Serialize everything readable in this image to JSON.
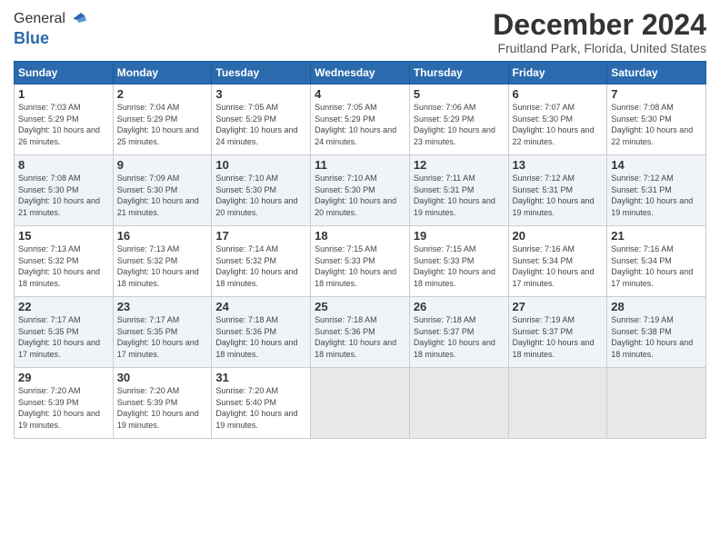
{
  "header": {
    "logo_general": "General",
    "logo_blue": "Blue",
    "month_title": "December 2024",
    "location": "Fruitland Park, Florida, United States"
  },
  "calendar": {
    "days_of_week": [
      "Sunday",
      "Monday",
      "Tuesday",
      "Wednesday",
      "Thursday",
      "Friday",
      "Saturday"
    ],
    "weeks": [
      [
        {
          "day": "",
          "empty": true
        },
        {
          "day": "",
          "empty": true
        },
        {
          "day": "",
          "empty": true
        },
        {
          "day": "",
          "empty": true
        },
        {
          "day": "",
          "empty": true
        },
        {
          "day": "",
          "empty": true
        },
        {
          "day": "",
          "empty": true
        }
      ]
    ],
    "cells": [
      {
        "date": "1",
        "sunrise": "7:03 AM",
        "sunset": "5:29 PM",
        "daylight": "10 hours and 26 minutes."
      },
      {
        "date": "2",
        "sunrise": "7:04 AM",
        "sunset": "5:29 PM",
        "daylight": "10 hours and 25 minutes."
      },
      {
        "date": "3",
        "sunrise": "7:05 AM",
        "sunset": "5:29 PM",
        "daylight": "10 hours and 24 minutes."
      },
      {
        "date": "4",
        "sunrise": "7:05 AM",
        "sunset": "5:29 PM",
        "daylight": "10 hours and 24 minutes."
      },
      {
        "date": "5",
        "sunrise": "7:06 AM",
        "sunset": "5:29 PM",
        "daylight": "10 hours and 23 minutes."
      },
      {
        "date": "6",
        "sunrise": "7:07 AM",
        "sunset": "5:30 PM",
        "daylight": "10 hours and 22 minutes."
      },
      {
        "date": "7",
        "sunrise": "7:08 AM",
        "sunset": "5:30 PM",
        "daylight": "10 hours and 22 minutes."
      },
      {
        "date": "8",
        "sunrise": "7:08 AM",
        "sunset": "5:30 PM",
        "daylight": "10 hours and 21 minutes."
      },
      {
        "date": "9",
        "sunrise": "7:09 AM",
        "sunset": "5:30 PM",
        "daylight": "10 hours and 21 minutes."
      },
      {
        "date": "10",
        "sunrise": "7:10 AM",
        "sunset": "5:30 PM",
        "daylight": "10 hours and 20 minutes."
      },
      {
        "date": "11",
        "sunrise": "7:10 AM",
        "sunset": "5:30 PM",
        "daylight": "10 hours and 20 minutes."
      },
      {
        "date": "12",
        "sunrise": "7:11 AM",
        "sunset": "5:31 PM",
        "daylight": "10 hours and 19 minutes."
      },
      {
        "date": "13",
        "sunrise": "7:12 AM",
        "sunset": "5:31 PM",
        "daylight": "10 hours and 19 minutes."
      },
      {
        "date": "14",
        "sunrise": "7:12 AM",
        "sunset": "5:31 PM",
        "daylight": "10 hours and 19 minutes."
      },
      {
        "date": "15",
        "sunrise": "7:13 AM",
        "sunset": "5:32 PM",
        "daylight": "10 hours and 18 minutes."
      },
      {
        "date": "16",
        "sunrise": "7:13 AM",
        "sunset": "5:32 PM",
        "daylight": "10 hours and 18 minutes."
      },
      {
        "date": "17",
        "sunrise": "7:14 AM",
        "sunset": "5:32 PM",
        "daylight": "10 hours and 18 minutes."
      },
      {
        "date": "18",
        "sunrise": "7:15 AM",
        "sunset": "5:33 PM",
        "daylight": "10 hours and 18 minutes."
      },
      {
        "date": "19",
        "sunrise": "7:15 AM",
        "sunset": "5:33 PM",
        "daylight": "10 hours and 18 minutes."
      },
      {
        "date": "20",
        "sunrise": "7:16 AM",
        "sunset": "5:34 PM",
        "daylight": "10 hours and 17 minutes."
      },
      {
        "date": "21",
        "sunrise": "7:16 AM",
        "sunset": "5:34 PM",
        "daylight": "10 hours and 17 minutes."
      },
      {
        "date": "22",
        "sunrise": "7:17 AM",
        "sunset": "5:35 PM",
        "daylight": "10 hours and 17 minutes."
      },
      {
        "date": "23",
        "sunrise": "7:17 AM",
        "sunset": "5:35 PM",
        "daylight": "10 hours and 17 minutes."
      },
      {
        "date": "24",
        "sunrise": "7:18 AM",
        "sunset": "5:36 PM",
        "daylight": "10 hours and 18 minutes."
      },
      {
        "date": "25",
        "sunrise": "7:18 AM",
        "sunset": "5:36 PM",
        "daylight": "10 hours and 18 minutes."
      },
      {
        "date": "26",
        "sunrise": "7:18 AM",
        "sunset": "5:37 PM",
        "daylight": "10 hours and 18 minutes."
      },
      {
        "date": "27",
        "sunrise": "7:19 AM",
        "sunset": "5:37 PM",
        "daylight": "10 hours and 18 minutes."
      },
      {
        "date": "28",
        "sunrise": "7:19 AM",
        "sunset": "5:38 PM",
        "daylight": "10 hours and 18 minutes."
      },
      {
        "date": "29",
        "sunrise": "7:20 AM",
        "sunset": "5:39 PM",
        "daylight": "10 hours and 19 minutes."
      },
      {
        "date": "30",
        "sunrise": "7:20 AM",
        "sunset": "5:39 PM",
        "daylight": "10 hours and 19 minutes."
      },
      {
        "date": "31",
        "sunrise": "7:20 AM",
        "sunset": "5:40 PM",
        "daylight": "10 hours and 19 minutes."
      }
    ]
  }
}
